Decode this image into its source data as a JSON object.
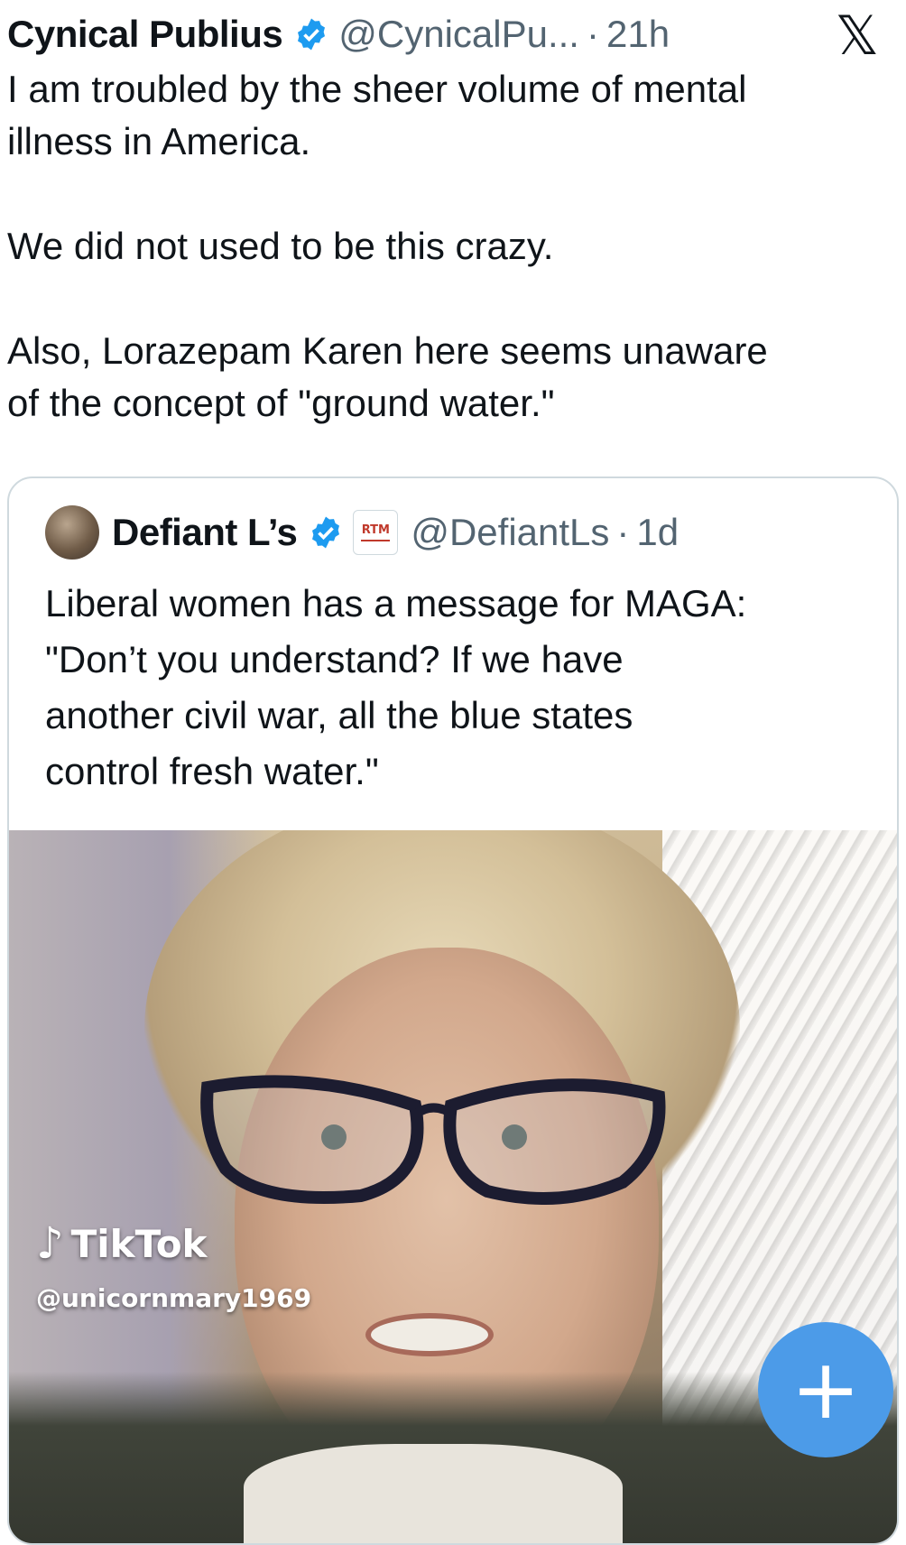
{
  "tweet": {
    "author_name": "Cynical Publius",
    "handle": "@CynicalPu...",
    "separator": "·",
    "time": "21h",
    "text": "I am troubled by the sheer volume of mental\nillness in America.\n\nWe did not used to be this crazy.\n\nAlso, Lorazepam Karen here seems unaware\nof the concept of \"ground water.\""
  },
  "quote": {
    "author_name": "Defiant L’s",
    "badge_text": "RTM",
    "handle": "@DefiantLs",
    "separator": "·",
    "time": "1d",
    "text": "Liberal women has a message for MAGA:\n\"Don’t you understand? If we have\nanother civil war, all the blue states\ncontrol fresh water.\"",
    "video": {
      "watermark_brand": "TikTok",
      "watermark_handle": "@unicornmary1969"
    }
  },
  "fab": {
    "label": "+"
  },
  "icons": {
    "verified": "verified-badge-icon",
    "x_logo": "x-logo-icon",
    "tiktok": "tiktok-note-icon",
    "compose": "plus-icon"
  },
  "colors": {
    "verified": "#1d9bf0",
    "fab": "#4c9be8",
    "secondary_text": "#536471",
    "border": "#cfd9de"
  }
}
